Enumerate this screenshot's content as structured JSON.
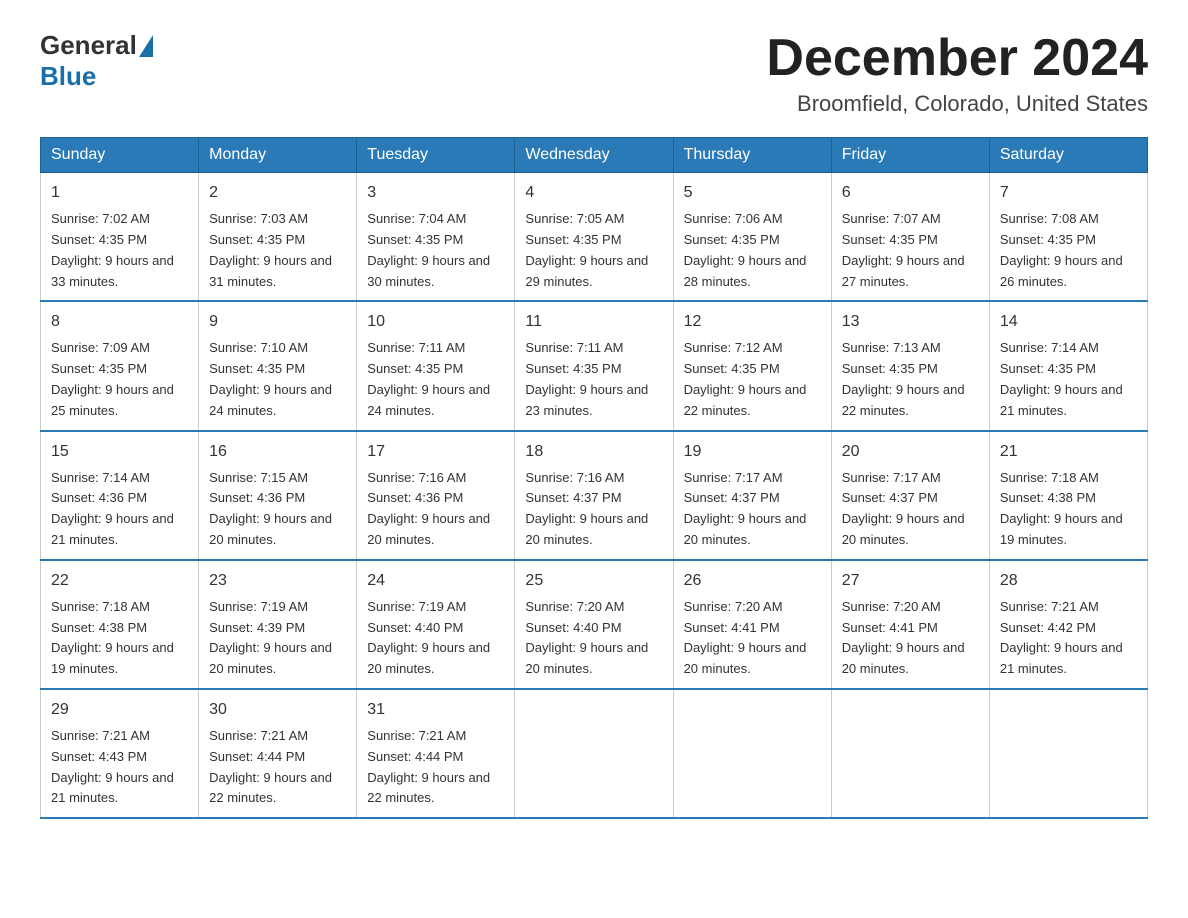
{
  "header": {
    "title": "December 2024",
    "location": "Broomfield, Colorado, United States",
    "logo_general": "General",
    "logo_blue": "Blue"
  },
  "days_of_week": [
    "Sunday",
    "Monday",
    "Tuesday",
    "Wednesday",
    "Thursday",
    "Friday",
    "Saturday"
  ],
  "weeks": [
    [
      {
        "day": "1",
        "sunrise": "7:02 AM",
        "sunset": "4:35 PM",
        "daylight": "9 hours and 33 minutes."
      },
      {
        "day": "2",
        "sunrise": "7:03 AM",
        "sunset": "4:35 PM",
        "daylight": "9 hours and 31 minutes."
      },
      {
        "day": "3",
        "sunrise": "7:04 AM",
        "sunset": "4:35 PM",
        "daylight": "9 hours and 30 minutes."
      },
      {
        "day": "4",
        "sunrise": "7:05 AM",
        "sunset": "4:35 PM",
        "daylight": "9 hours and 29 minutes."
      },
      {
        "day": "5",
        "sunrise": "7:06 AM",
        "sunset": "4:35 PM",
        "daylight": "9 hours and 28 minutes."
      },
      {
        "day": "6",
        "sunrise": "7:07 AM",
        "sunset": "4:35 PM",
        "daylight": "9 hours and 27 minutes."
      },
      {
        "day": "7",
        "sunrise": "7:08 AM",
        "sunset": "4:35 PM",
        "daylight": "9 hours and 26 minutes."
      }
    ],
    [
      {
        "day": "8",
        "sunrise": "7:09 AM",
        "sunset": "4:35 PM",
        "daylight": "9 hours and 25 minutes."
      },
      {
        "day": "9",
        "sunrise": "7:10 AM",
        "sunset": "4:35 PM",
        "daylight": "9 hours and 24 minutes."
      },
      {
        "day": "10",
        "sunrise": "7:11 AM",
        "sunset": "4:35 PM",
        "daylight": "9 hours and 24 minutes."
      },
      {
        "day": "11",
        "sunrise": "7:11 AM",
        "sunset": "4:35 PM",
        "daylight": "9 hours and 23 minutes."
      },
      {
        "day": "12",
        "sunrise": "7:12 AM",
        "sunset": "4:35 PM",
        "daylight": "9 hours and 22 minutes."
      },
      {
        "day": "13",
        "sunrise": "7:13 AM",
        "sunset": "4:35 PM",
        "daylight": "9 hours and 22 minutes."
      },
      {
        "day": "14",
        "sunrise": "7:14 AM",
        "sunset": "4:35 PM",
        "daylight": "9 hours and 21 minutes."
      }
    ],
    [
      {
        "day": "15",
        "sunrise": "7:14 AM",
        "sunset": "4:36 PM",
        "daylight": "9 hours and 21 minutes."
      },
      {
        "day": "16",
        "sunrise": "7:15 AM",
        "sunset": "4:36 PM",
        "daylight": "9 hours and 20 minutes."
      },
      {
        "day": "17",
        "sunrise": "7:16 AM",
        "sunset": "4:36 PM",
        "daylight": "9 hours and 20 minutes."
      },
      {
        "day": "18",
        "sunrise": "7:16 AM",
        "sunset": "4:37 PM",
        "daylight": "9 hours and 20 minutes."
      },
      {
        "day": "19",
        "sunrise": "7:17 AM",
        "sunset": "4:37 PM",
        "daylight": "9 hours and 20 minutes."
      },
      {
        "day": "20",
        "sunrise": "7:17 AM",
        "sunset": "4:37 PM",
        "daylight": "9 hours and 20 minutes."
      },
      {
        "day": "21",
        "sunrise": "7:18 AM",
        "sunset": "4:38 PM",
        "daylight": "9 hours and 19 minutes."
      }
    ],
    [
      {
        "day": "22",
        "sunrise": "7:18 AM",
        "sunset": "4:38 PM",
        "daylight": "9 hours and 19 minutes."
      },
      {
        "day": "23",
        "sunrise": "7:19 AM",
        "sunset": "4:39 PM",
        "daylight": "9 hours and 20 minutes."
      },
      {
        "day": "24",
        "sunrise": "7:19 AM",
        "sunset": "4:40 PM",
        "daylight": "9 hours and 20 minutes."
      },
      {
        "day": "25",
        "sunrise": "7:20 AM",
        "sunset": "4:40 PM",
        "daylight": "9 hours and 20 minutes."
      },
      {
        "day": "26",
        "sunrise": "7:20 AM",
        "sunset": "4:41 PM",
        "daylight": "9 hours and 20 minutes."
      },
      {
        "day": "27",
        "sunrise": "7:20 AM",
        "sunset": "4:41 PM",
        "daylight": "9 hours and 20 minutes."
      },
      {
        "day": "28",
        "sunrise": "7:21 AM",
        "sunset": "4:42 PM",
        "daylight": "9 hours and 21 minutes."
      }
    ],
    [
      {
        "day": "29",
        "sunrise": "7:21 AM",
        "sunset": "4:43 PM",
        "daylight": "9 hours and 21 minutes."
      },
      {
        "day": "30",
        "sunrise": "7:21 AM",
        "sunset": "4:44 PM",
        "daylight": "9 hours and 22 minutes."
      },
      {
        "day": "31",
        "sunrise": "7:21 AM",
        "sunset": "4:44 PM",
        "daylight": "9 hours and 22 minutes."
      },
      null,
      null,
      null,
      null
    ]
  ]
}
